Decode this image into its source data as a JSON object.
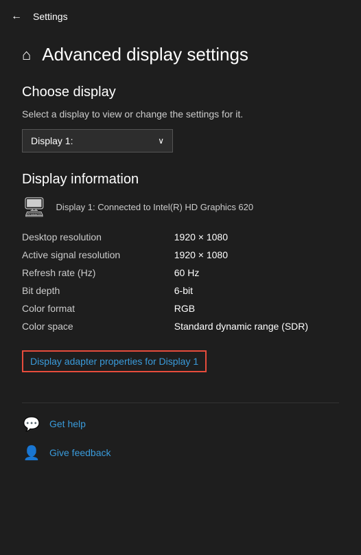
{
  "titleBar": {
    "backLabel": "←",
    "title": "Settings"
  },
  "pageHeader": {
    "homeIcon": "⌂",
    "title": "Advanced display settings"
  },
  "chooseDisplay": {
    "sectionTitle": "Choose display",
    "description": "Select a display to view or change the settings for it.",
    "dropdownValue": "Display 1:",
    "dropdownArrow": "∨"
  },
  "displayInfo": {
    "sectionTitle": "Display information",
    "monitorIcon": "🖥",
    "connectedText": "Display 1: Connected to Intel(R) HD Graphics 620",
    "rows": [
      {
        "label": "Desktop resolution",
        "value": "1920 × 1080"
      },
      {
        "label": "Active signal resolution",
        "value": "1920 × 1080"
      },
      {
        "label": "Refresh rate (Hz)",
        "value": "60 Hz"
      },
      {
        "label": "Bit depth",
        "value": "6-bit"
      },
      {
        "label": "Color format",
        "value": "RGB"
      },
      {
        "label": "Color space",
        "value": "Standard dynamic range (SDR)"
      }
    ],
    "adapterLinkText": "Display adapter properties for Display 1"
  },
  "footerLinks": [
    {
      "icon": "💬",
      "text": "Get help"
    },
    {
      "icon": "👤",
      "text": "Give feedback"
    }
  ]
}
